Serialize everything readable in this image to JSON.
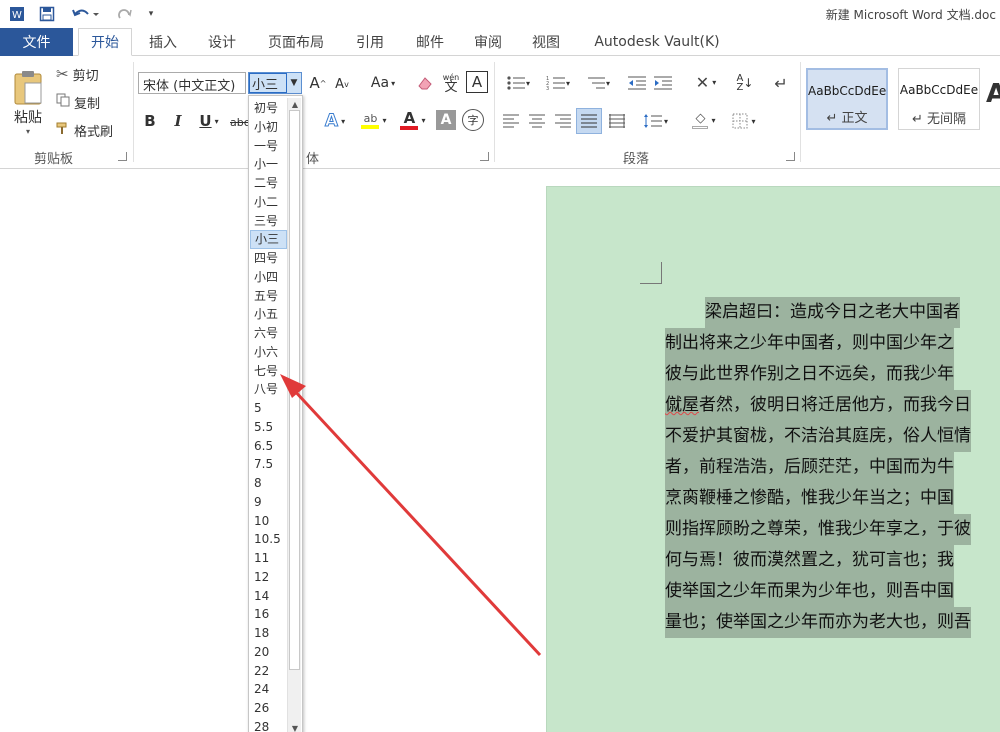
{
  "titlebar": {
    "app_icon": "W",
    "save_icon": "save-icon",
    "undo_icon": "undo-icon",
    "redo_icon": "redo-icon",
    "title": "新建 Microsoft Word 文档.doc"
  },
  "tabs": {
    "file": "文件",
    "items": [
      "开始",
      "插入",
      "设计",
      "页面布局",
      "引用",
      "邮件",
      "审阅",
      "视图",
      "Autodesk Vault(K)"
    ]
  },
  "clipboard": {
    "paste": "粘贴",
    "cut": "剪切",
    "copy": "复制",
    "format_painter": "格式刷",
    "group_label": "剪贴板"
  },
  "font": {
    "name": "宋体 (中文正文)",
    "size": "小三",
    "group_label_partial": "体",
    "bold": "B",
    "italic": "I",
    "underline": "U",
    "strike": "abc",
    "grow": "A",
    "shrink": "A",
    "case": "Aa",
    "phonetic": "wén",
    "border_char": "A",
    "font_color": "A",
    "shade": "A",
    "enclose": "字"
  },
  "paragraph": {
    "group_label": "段落"
  },
  "styles": {
    "items": [
      {
        "sample": "AaBbCcDdEe",
        "name": "↵ 正文",
        "selected": true
      },
      {
        "sample": "AaBbCcDdEe",
        "name": "↵ 无间隔",
        "selected": false
      }
    ],
    "partial": "A"
  },
  "size_dropdown": {
    "items": [
      "初号",
      "小初",
      "一号",
      "小一",
      "二号",
      "小二",
      "三号",
      "小三",
      "四号",
      "小四",
      "五号",
      "小五",
      "六号",
      "小六",
      "七号",
      "八号",
      "5",
      "5.5",
      "6.5",
      "7.5",
      "8",
      "9",
      "10",
      "10.5",
      "11",
      "12",
      "14",
      "16",
      "18",
      "20",
      "22",
      "24",
      "26",
      "28"
    ],
    "highlighted": "小三"
  },
  "document": {
    "lines": [
      "梁启超曰：造成今日之老大中国者",
      "制出将来之少年中国者，则中国少年之",
      "彼与此世界作别之日不远矣，而我少年",
      "僦屋者然，彼明日将迁居他方，而我今日",
      "不爱护其窗栊，不洁治其庭庑，俗人恒情",
      "者，前程浩浩，后顾茫茫，中国而为牛",
      "烹脔鞭棰之惨酷，惟我少年当之；中国",
      "则指挥顾盼之尊荣，惟我少年享之，于彼",
      "何与焉！彼而漠然置之，犹可言也；我",
      "使举国之少年而果为少年也，则吾中国",
      "量也；使举国之少年而亦为老大也，则吾"
    ]
  },
  "colors": {
    "file_tab": "#2b579a",
    "page_bg": "#c7e6cb",
    "selection": "#9cb39f",
    "arrow": "#e03a3a"
  }
}
